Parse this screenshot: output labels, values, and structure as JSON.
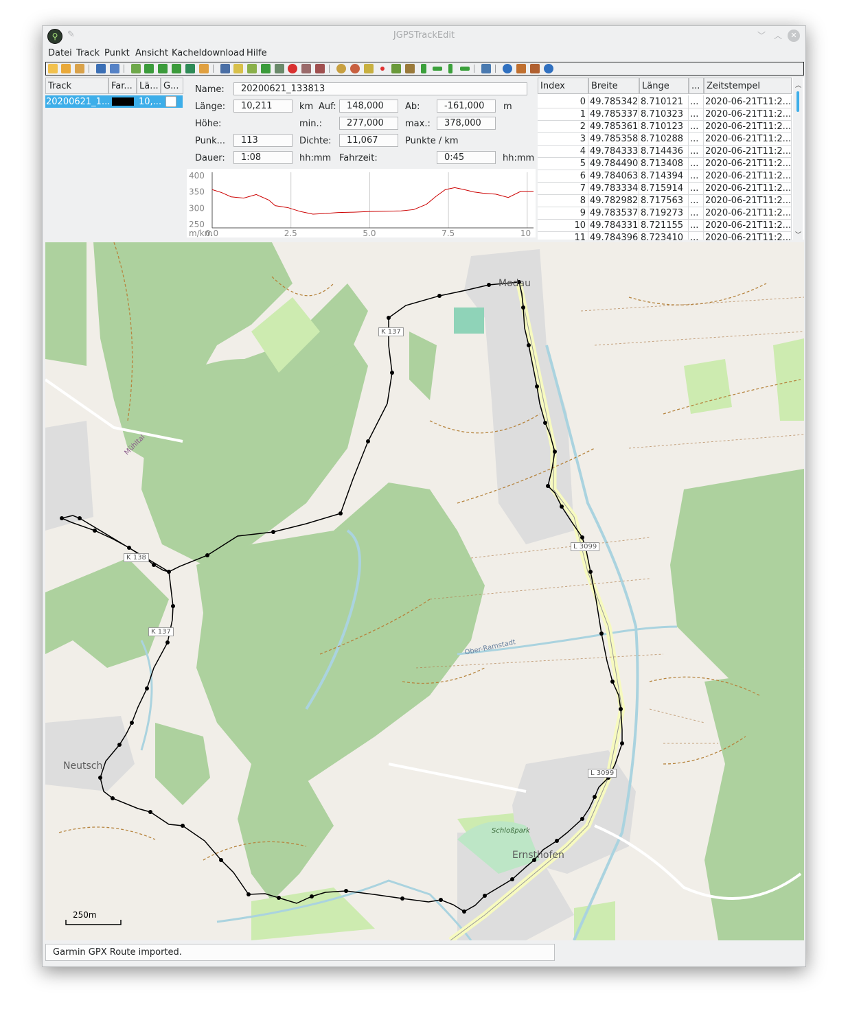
{
  "window": {
    "title": "JGPSTrackEdit"
  },
  "menu": [
    "Datei",
    "Track",
    "Punkt",
    "Ansicht",
    "Kacheldownload",
    "Hilfe"
  ],
  "tracks": {
    "headers": [
      "Track",
      "Far...",
      "Lä...",
      "G..."
    ],
    "row": {
      "name": "20200621_1...",
      "length": "10,..."
    }
  },
  "details": {
    "name_label": "Name:",
    "name_value": "20200621_133813",
    "length_label": "Länge:",
    "length_value": "10,211",
    "length_unit": "km",
    "up_label": "Auf:",
    "up_value": "148,000",
    "down_label": "Ab:",
    "down_value": "-161,000",
    "elev_unit": "m",
    "height_label": "Höhe:",
    "min_label": "min.:",
    "min_value": "277,000",
    "max_label": "max.:",
    "max_value": "378,000",
    "points_label": "Punk...",
    "points_value": "113",
    "density_label": "Dichte:",
    "density_value": "11,067",
    "density_unit": "Punkte / km",
    "duration_label": "Dauer:",
    "duration_value": "1:08",
    "duration_unit": "hh:mm",
    "ride_label": "Fahrzeit:",
    "ride_value": "0:45",
    "ride_unit": "hh:mm"
  },
  "chart_data": {
    "type": "line",
    "xlabel": "m/km",
    "y_ticks": [
      "400",
      "350",
      "300",
      "250"
    ],
    "x_ticks": [
      "0.0",
      "2.5",
      "5.0",
      "7.5",
      "10"
    ],
    "xlim": [
      0,
      10.2
    ],
    "ylim": [
      240,
      410
    ],
    "series": [
      {
        "color": "#cc0000",
        "x": [
          0,
          0.3,
          0.6,
          1.0,
          1.4,
          1.8,
          2.0,
          2.4,
          2.8,
          3.2,
          3.6,
          4.0,
          4.5,
          5.0,
          5.5,
          6.0,
          6.4,
          6.8,
          7.1,
          7.4,
          7.7,
          8.0,
          8.3,
          8.6,
          9.0,
          9.4,
          9.8,
          10.2
        ],
        "y": [
          357,
          348,
          335,
          331,
          342,
          325,
          308,
          302,
          290,
          282,
          284,
          287,
          288,
          290,
          291,
          292,
          296,
          312,
          336,
          357,
          363,
          357,
          350,
          346,
          343,
          333,
          352,
          352
        ]
      }
    ]
  },
  "points": {
    "headers": [
      "Index",
      "Breite",
      "Länge",
      "...",
      "Zeitstempel"
    ],
    "rows": [
      [
        "0",
        "49.785342",
        "8.710121",
        "...",
        "2020-06-21T11:2..."
      ],
      [
        "1",
        "49.785337",
        "8.710323",
        "...",
        "2020-06-21T11:2..."
      ],
      [
        "2",
        "49.785361",
        "8.710123",
        "...",
        "2020-06-21T11:2..."
      ],
      [
        "3",
        "49.785358",
        "8.710288",
        "...",
        "2020-06-21T11:2..."
      ],
      [
        "4",
        "49.784333",
        "8.714436",
        "...",
        "2020-06-21T11:2..."
      ],
      [
        "5",
        "49.784490",
        "8.713408",
        "...",
        "2020-06-21T11:2..."
      ],
      [
        "6",
        "49.784063",
        "8.714394",
        "...",
        "2020-06-21T11:2..."
      ],
      [
        "7",
        "49.783334",
        "8.715914",
        "...",
        "2020-06-21T11:2..."
      ],
      [
        "8",
        "49.782982",
        "8.717563",
        "...",
        "2020-06-21T11:2..."
      ],
      [
        "9",
        "49.783537",
        "8.719273",
        "...",
        "2020-06-21T11:2..."
      ],
      [
        "10",
        "49.784331",
        "8.721155",
        "...",
        "2020-06-21T11:2..."
      ],
      [
        "11",
        "49.784396",
        "8.723410",
        "...",
        "2020-06-21T11:2..."
      ]
    ]
  },
  "map": {
    "labels": {
      "modau": "Modau",
      "neutsch": "Neutsch",
      "ernsthofen": "Ernsthofen",
      "k137a": "K 137",
      "k137b": "K 137",
      "k138": "K 138",
      "l3099a": "L 3099",
      "l3099b": "L 3099",
      "oberramstadt": "Ober-Ramstadt",
      "muehltal": "Mühltal",
      "schlosspark": "Schloßpark",
      "scale": "250m"
    }
  },
  "status": {
    "message": "Garmin GPX Route imported."
  }
}
